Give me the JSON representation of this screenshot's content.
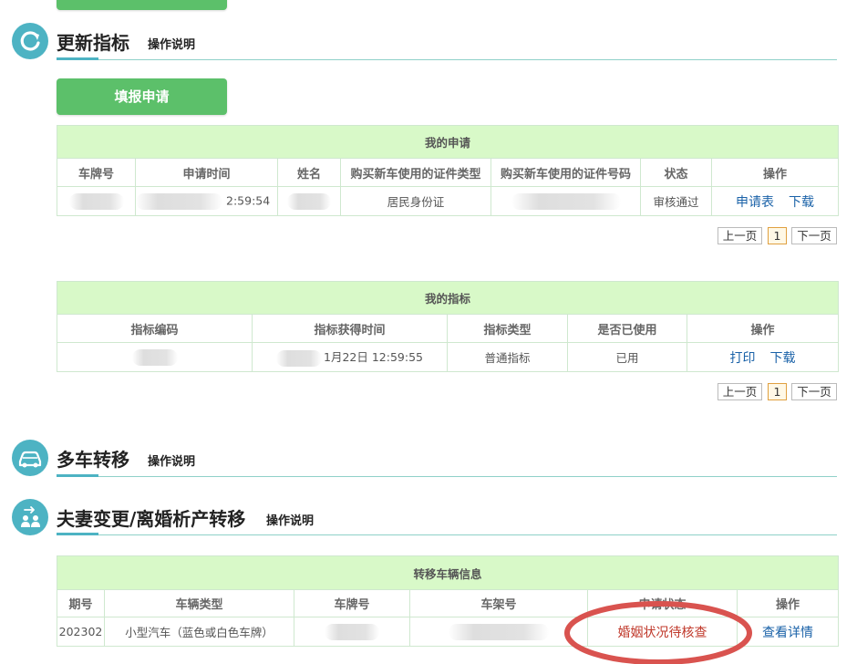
{
  "top_button_label": "",
  "section_update": {
    "title": "更新指标",
    "help": "操作说明",
    "apply_button": "填报申请"
  },
  "my_applications": {
    "caption": "我的申请",
    "columns": [
      "车牌号",
      "申请时间",
      "姓名",
      "购买新车使用的证件类型",
      "购买新车使用的证件号码",
      "状态",
      "操作"
    ],
    "row": {
      "time_suffix": "2:59:54",
      "id_type": "居民身份证",
      "status": "审核通过",
      "action_form": "申请表",
      "action_download": "下载"
    },
    "pager": {
      "prev": "上一页",
      "page": "1",
      "next": "下一页"
    }
  },
  "my_quota": {
    "caption": "我的指标",
    "columns": [
      "指标编码",
      "指标获得时间",
      "指标类型",
      "是否已使用",
      "操作"
    ],
    "row": {
      "time_visible": "1月22日 12:59:55",
      "type": "普通指标",
      "used": "已用",
      "action_print": "打印",
      "action_download": "下载"
    },
    "pager": {
      "prev": "上一页",
      "page": "1",
      "next": "下一页"
    }
  },
  "section_multi": {
    "title": "多车转移",
    "help": "操作说明"
  },
  "section_spouse": {
    "title": "夫妻变更/离婚析产转移",
    "help": "操作说明"
  },
  "transfer_vehicle": {
    "caption": "转移车辆信息",
    "columns": [
      "期号",
      "车辆类型",
      "车牌号",
      "车架号",
      "申请状态",
      "操作"
    ],
    "row": {
      "period": "202302",
      "vehicle_type": "小型汽车（蓝色或白色车牌）",
      "status": "婚姻状况待核查",
      "action": "查看详情"
    }
  },
  "colors": {
    "accent": "#4db3c3",
    "green_button": "#5cc06a",
    "caption_bg": "#d8f9c8",
    "link": "#1a62a8",
    "alert": "#c0392b",
    "annotation": "#d9534f"
  }
}
